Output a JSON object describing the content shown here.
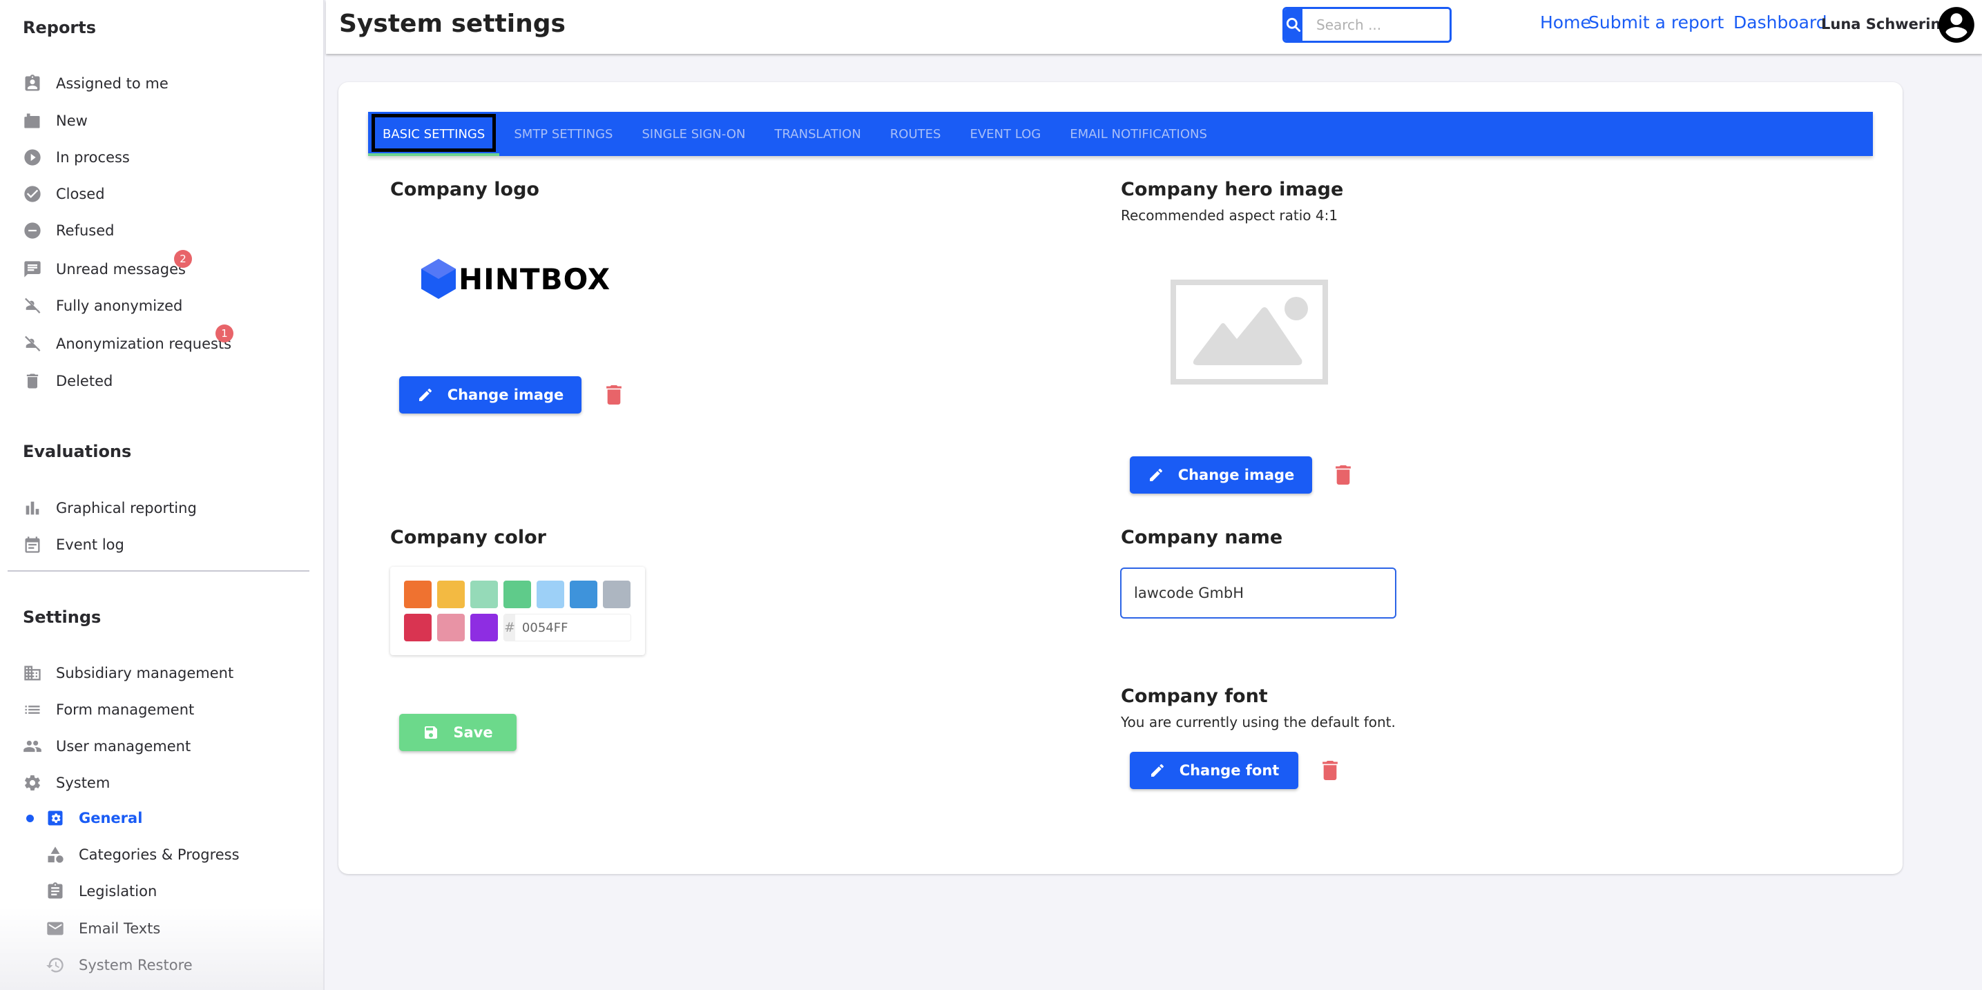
{
  "sidebar": {
    "reports_heading": "Reports",
    "reports_items": [
      {
        "label": "Assigned to me",
        "icon": "assigned-badge-icon"
      },
      {
        "label": "New",
        "icon": "new-folder-icon"
      },
      {
        "label": "In process",
        "icon": "play-circle-icon"
      },
      {
        "label": "Closed",
        "icon": "check-circle-icon"
      },
      {
        "label": "Refused",
        "icon": "minus-circle-icon"
      },
      {
        "label": "Unread messages",
        "icon": "message-icon",
        "badge": "2"
      },
      {
        "label": "Fully anonymized",
        "icon": "person-off-icon"
      },
      {
        "label": "Anonymization requests",
        "icon": "person-off-icon",
        "badge": "1"
      },
      {
        "label": "Deleted",
        "icon": "trash-icon"
      }
    ],
    "evaluations_heading": "Evaluations",
    "evaluations_items": [
      {
        "label": "Graphical reporting",
        "icon": "bar-chart-icon"
      },
      {
        "label": "Event log",
        "icon": "calendar-icon"
      }
    ],
    "settings_heading": "Settings",
    "settings_items": [
      {
        "label": "Subsidiary management",
        "icon": "building-icon"
      },
      {
        "label": "Form management",
        "icon": "list-icon"
      },
      {
        "label": "User management",
        "icon": "people-icon"
      },
      {
        "label": "System",
        "icon": "gear-icon"
      }
    ],
    "system_subitems": [
      {
        "label": "General",
        "icon": "settings-box-icon",
        "active": true
      },
      {
        "label": "Categories & Progress",
        "icon": "shapes-icon"
      },
      {
        "label": "Legislation",
        "icon": "clipboard-icon"
      },
      {
        "label": "Email Texts",
        "icon": "mail-icon"
      },
      {
        "label": "System Restore",
        "icon": "history-icon"
      }
    ]
  },
  "header": {
    "title": "System settings",
    "search_placeholder": "Search ...",
    "nav": [
      "Home",
      "Submit a report",
      "Dashboard"
    ],
    "user_name": "Luna Schwerin"
  },
  "tabs": [
    {
      "label": "BASIC SETTINGS",
      "active": true
    },
    {
      "label": "SMTP SETTINGS"
    },
    {
      "label": "SINGLE SIGN-ON"
    },
    {
      "label": "TRANSLATION"
    },
    {
      "label": "ROUTES"
    },
    {
      "label": "EVENT LOG"
    },
    {
      "label": "EMAIL NOTIFICATIONS"
    }
  ],
  "logo_section": {
    "title": "Company logo",
    "logo_text": "HINTBOX",
    "change_label": "Change image"
  },
  "hero_section": {
    "title": "Company hero image",
    "subtitle": "Recommended aspect ratio 4:1",
    "change_label": "Change image"
  },
  "color_section": {
    "title": "Company color",
    "swatches": [
      "#EF7230",
      "#F3BA42",
      "#95DAB8",
      "#5FCB8A",
      "#9DD0F7",
      "#3E93DB",
      "#ADB6C1",
      "#D93451",
      "#E893A5",
      "#8E2DE2"
    ],
    "hash": "#",
    "hex_value": "0054FF",
    "save_label": "Save"
  },
  "name_section": {
    "title": "Company name",
    "value": "lawcode GmbH"
  },
  "font_section": {
    "title": "Company font",
    "subtitle": "You are currently using the default font.",
    "change_label": "Change font"
  },
  "colors": {
    "accent": "#1A5CF5",
    "save_green": "#6CD98B",
    "danger": "#E86469",
    "tab_active_underline": "#6FD38F"
  }
}
